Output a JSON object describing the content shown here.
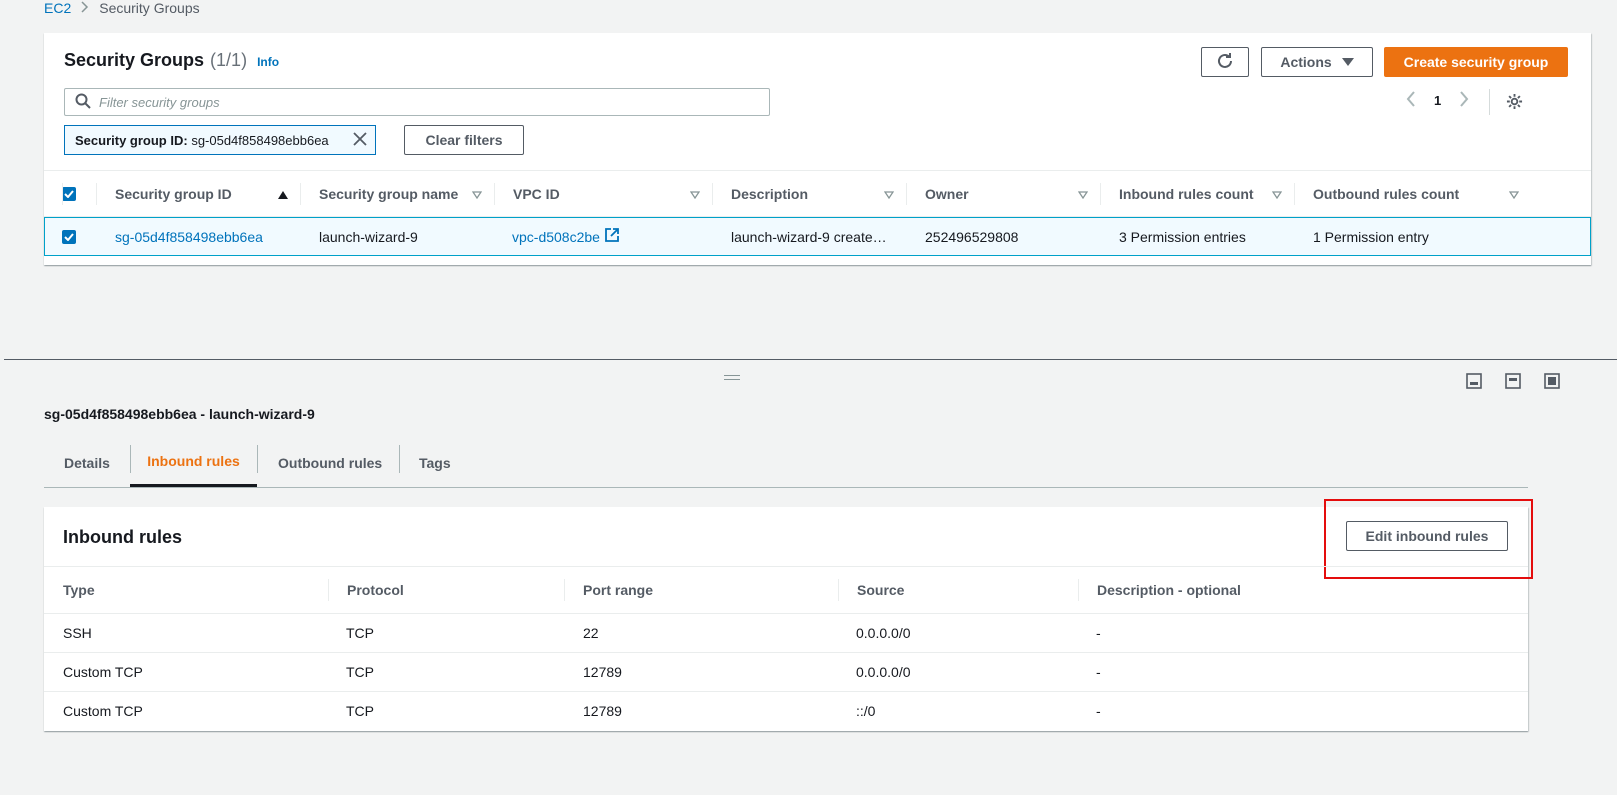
{
  "breadcrumb": {
    "root": "EC2",
    "current": "Security Groups"
  },
  "sg_panel": {
    "title": "Security Groups",
    "count": "(1/1)",
    "info": "Info",
    "actions_label": "Actions",
    "create_label": "Create security group",
    "search_placeholder": "Filter security groups",
    "page_number": "1",
    "filter_token_key": "Security group ID:",
    "filter_token_value": "sg-05d4f858498ebb6ea",
    "clear_filters_label": "Clear filters",
    "columns": [
      "Security group ID",
      "Security group name",
      "VPC ID",
      "Description",
      "Owner",
      "Inbound rules count",
      "Outbound rules count"
    ],
    "row": {
      "id": "sg-05d4f858498ebb6ea",
      "name": "launch-wizard-9",
      "vpc": "vpc-d508c2be",
      "description": "launch-wizard-9 create…",
      "owner": "252496529808",
      "inbound": "3 Permission entries",
      "outbound": "1 Permission entry"
    }
  },
  "detail": {
    "title": "sg-05d4f858498ebb6ea - launch-wizard-9",
    "tabs": [
      "Details",
      "Inbound rules",
      "Outbound rules",
      "Tags"
    ],
    "active_tab": "Inbound rules"
  },
  "inbound": {
    "title": "Inbound rules",
    "edit_label": "Edit inbound rules",
    "columns": [
      "Type",
      "Protocol",
      "Port range",
      "Source",
      "Description - optional"
    ],
    "rows": [
      {
        "type": "SSH",
        "protocol": "TCP",
        "port": "22",
        "source": "0.0.0.0/0",
        "desc": "-"
      },
      {
        "type": "Custom TCP",
        "protocol": "TCP",
        "port": "12789",
        "source": "0.0.0.0/0",
        "desc": "-"
      },
      {
        "type": "Custom TCP",
        "protocol": "TCP",
        "port": "12789",
        "source": "::/0",
        "desc": "-"
      }
    ]
  },
  "colors": {
    "accent": "#ec7211",
    "link": "#0073bb",
    "highlight": "#e40d0d"
  }
}
